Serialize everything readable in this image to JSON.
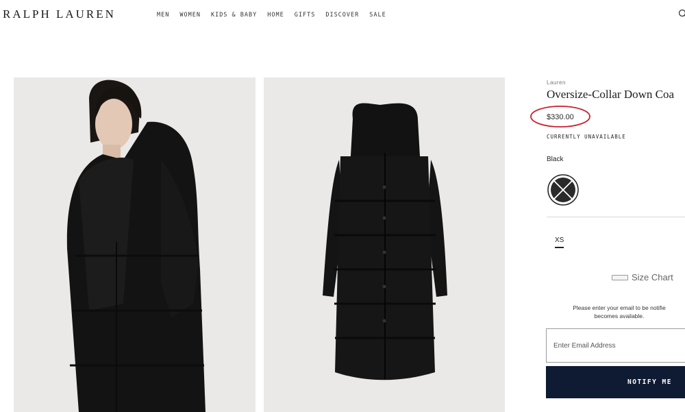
{
  "header": {
    "logo": "RALPH LAUREN",
    "nav": [
      "MEN",
      "WOMEN",
      "KIDS & BABY",
      "HOME",
      "GIFTS",
      "DISCOVER",
      "SALE"
    ]
  },
  "product": {
    "brand": "Lauren",
    "title": "Oversize-Collar Down Coa",
    "price": "$330.00",
    "availability": "CURRENTLY UNAVAILABLE",
    "color_label": "Black",
    "sizes": [
      "XS"
    ],
    "size_chart_label": "Size Chart"
  },
  "notify": {
    "message_line1": "Please enter your email to be notifie",
    "message_line2": "becomes available.",
    "email_placeholder": "Enter Email Address",
    "button_label": "NOTIFY ME"
  },
  "colors": {
    "notify_button": "#0f1b33",
    "price_circle": "#c8202e",
    "image_background": "#ebe9e7"
  },
  "icons": [
    "search-icon",
    "ruler-icon",
    "unavailable-swatch-icon"
  ]
}
